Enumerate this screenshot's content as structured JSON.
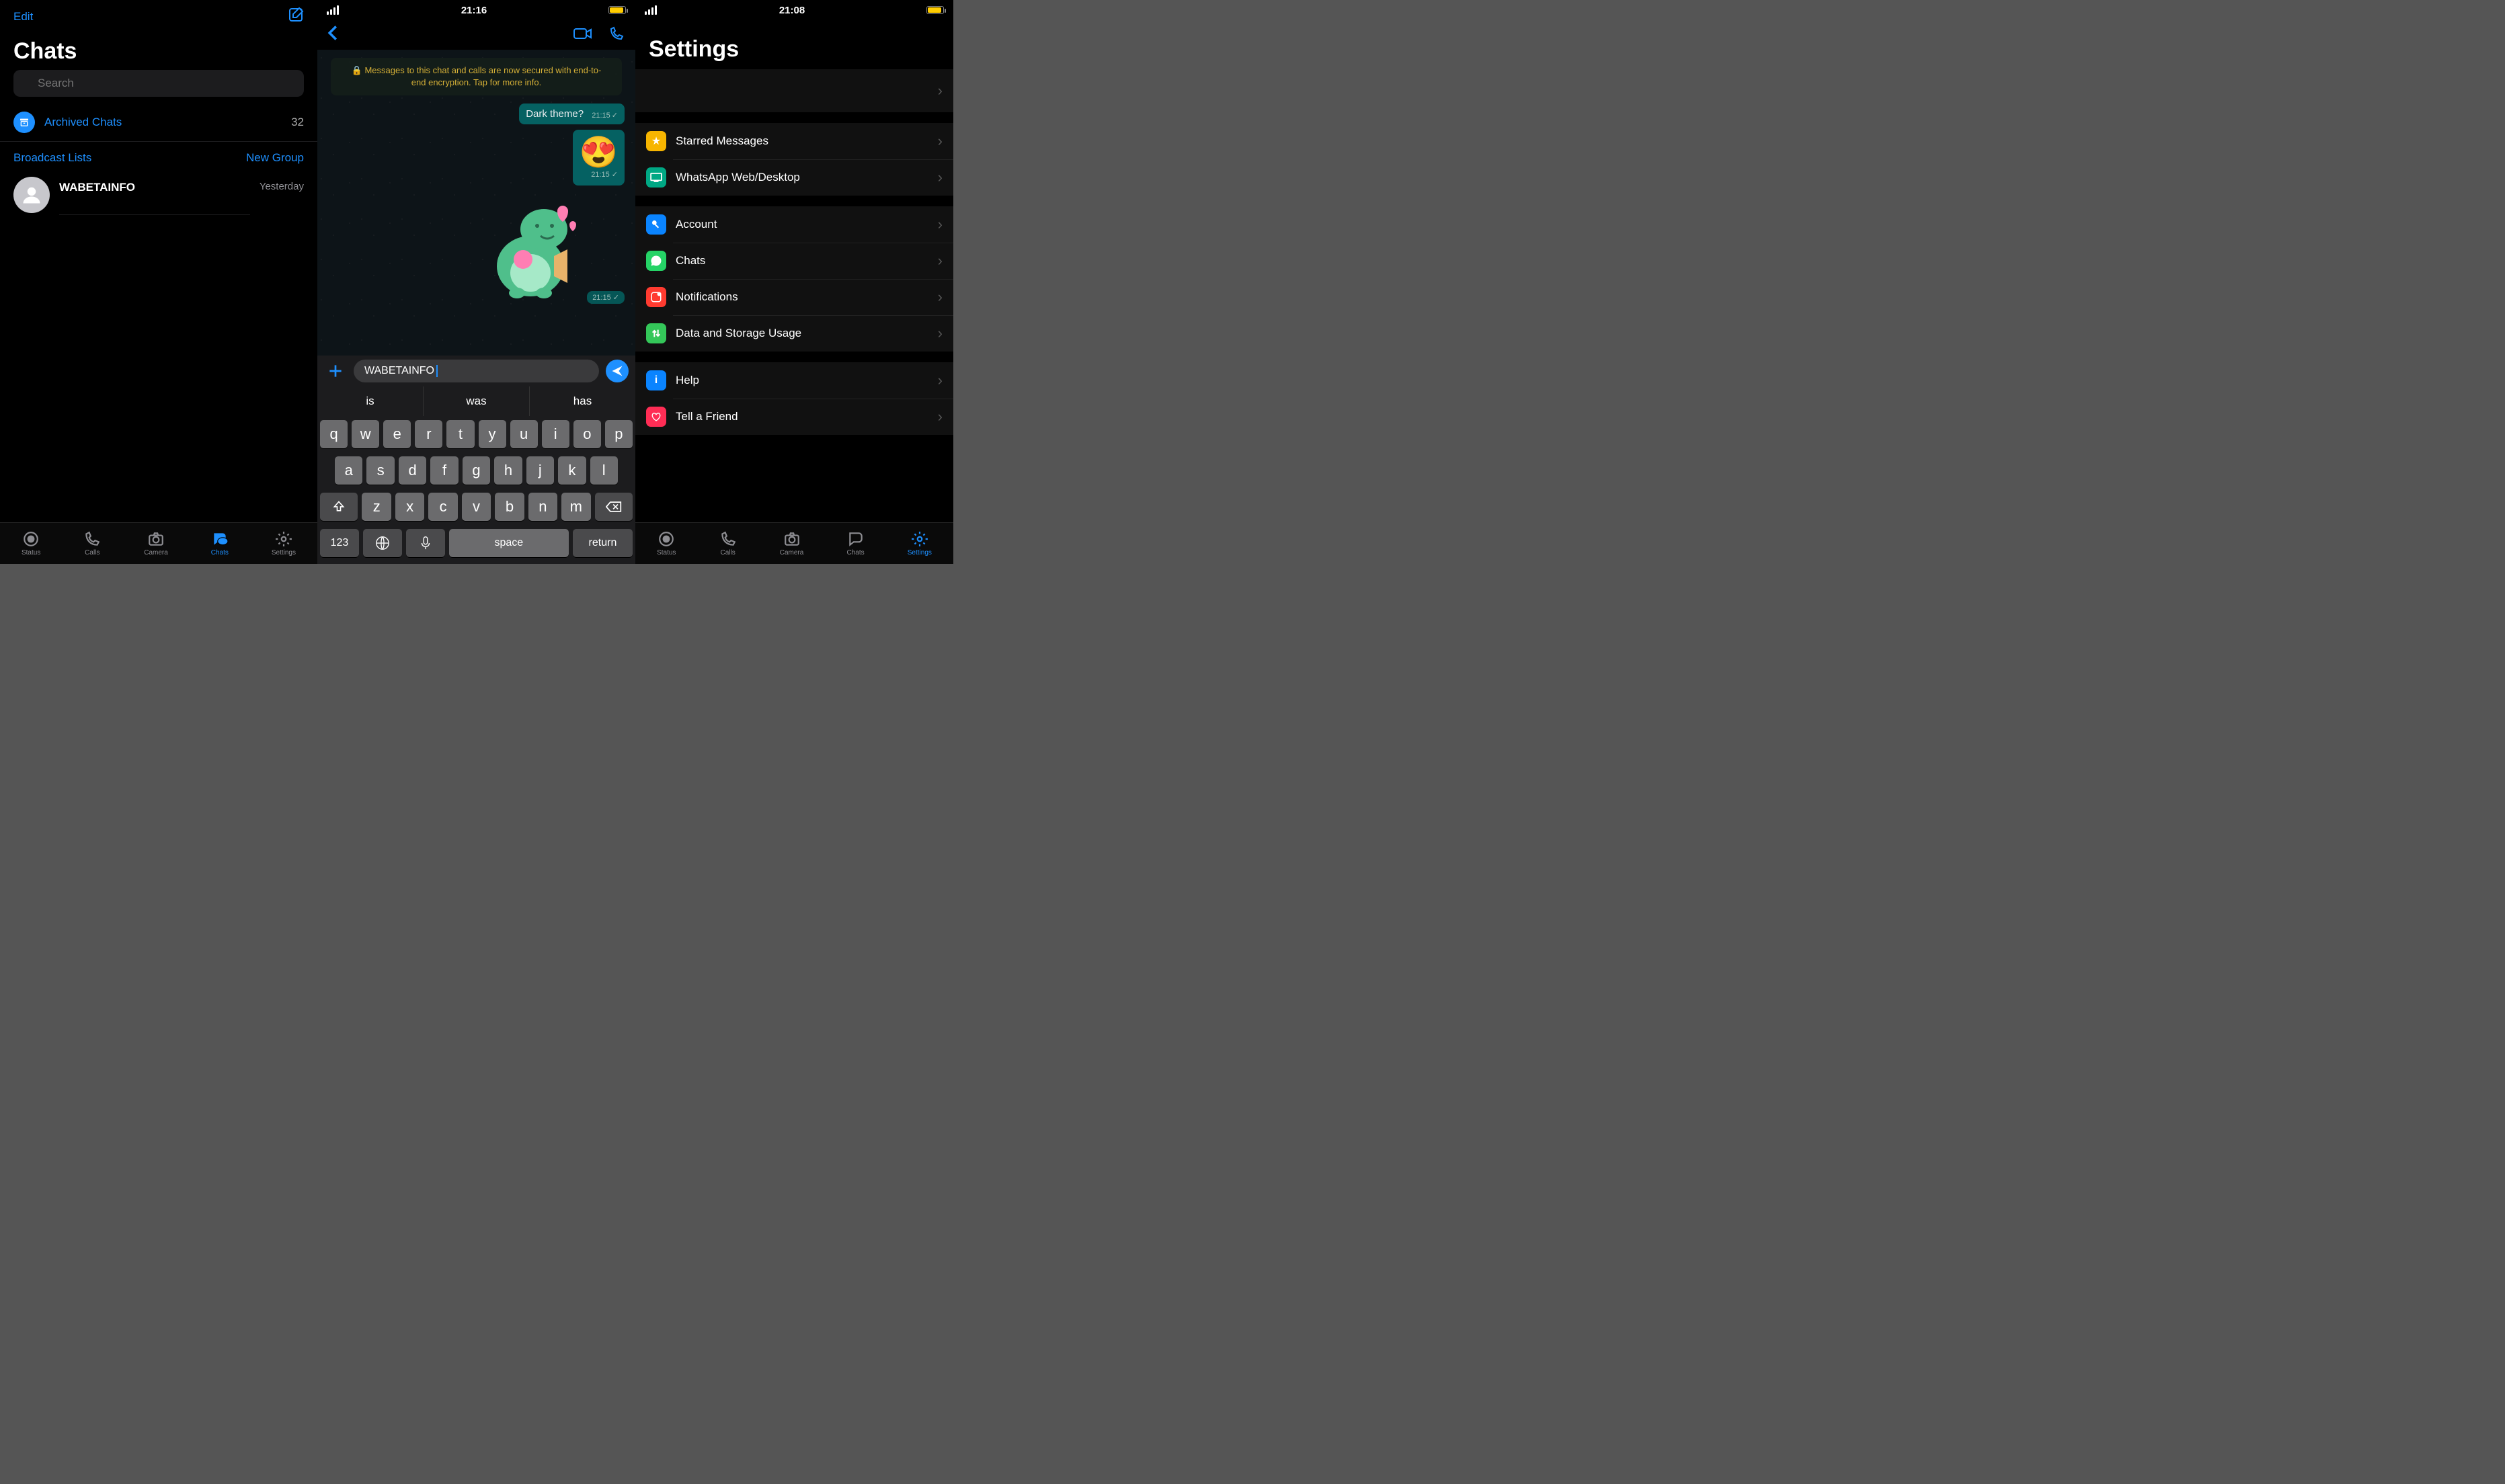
{
  "pane1": {
    "edit": "Edit",
    "title": "Chats",
    "search_placeholder": "Search",
    "archived_label": "Archived Chats",
    "archived_count": "32",
    "broadcast": "Broadcast Lists",
    "newgroup": "New Group",
    "chat_name": "WABETAINFO",
    "chat_time": "Yesterday",
    "tabs": {
      "status": "Status",
      "calls": "Calls",
      "camera": "Camera",
      "chats": "Chats",
      "settings": "Settings"
    }
  },
  "pane2": {
    "time": "21:16",
    "encryption_banner": "Messages to this chat and calls are now secured with end-to-end encryption. Tap for more info.",
    "msg1": {
      "text": "Dark theme?",
      "time": "21:15"
    },
    "msg2": {
      "time": "21:15"
    },
    "msg3": {
      "time": "21:15"
    },
    "input_value": "WABETAINFO",
    "suggestions": [
      "is",
      "was",
      "has"
    ],
    "keys_row1": [
      "q",
      "w",
      "e",
      "r",
      "t",
      "y",
      "u",
      "i",
      "o",
      "p"
    ],
    "keys_row2": [
      "a",
      "s",
      "d",
      "f",
      "g",
      "h",
      "j",
      "k",
      "l"
    ],
    "keys_row3": [
      "z",
      "x",
      "c",
      "v",
      "b",
      "n",
      "m"
    ],
    "k123": "123",
    "kspace": "space",
    "kreturn": "return"
  },
  "pane3": {
    "time": "21:08",
    "title": "Settings",
    "rows": {
      "starred": "Starred Messages",
      "web": "WhatsApp Web/Desktop",
      "account": "Account",
      "chats": "Chats",
      "notif": "Notifications",
      "data": "Data and Storage Usage",
      "help": "Help",
      "tell": "Tell a Friend"
    },
    "tabs": {
      "status": "Status",
      "calls": "Calls",
      "camera": "Camera",
      "chats": "Chats",
      "settings": "Settings"
    }
  }
}
